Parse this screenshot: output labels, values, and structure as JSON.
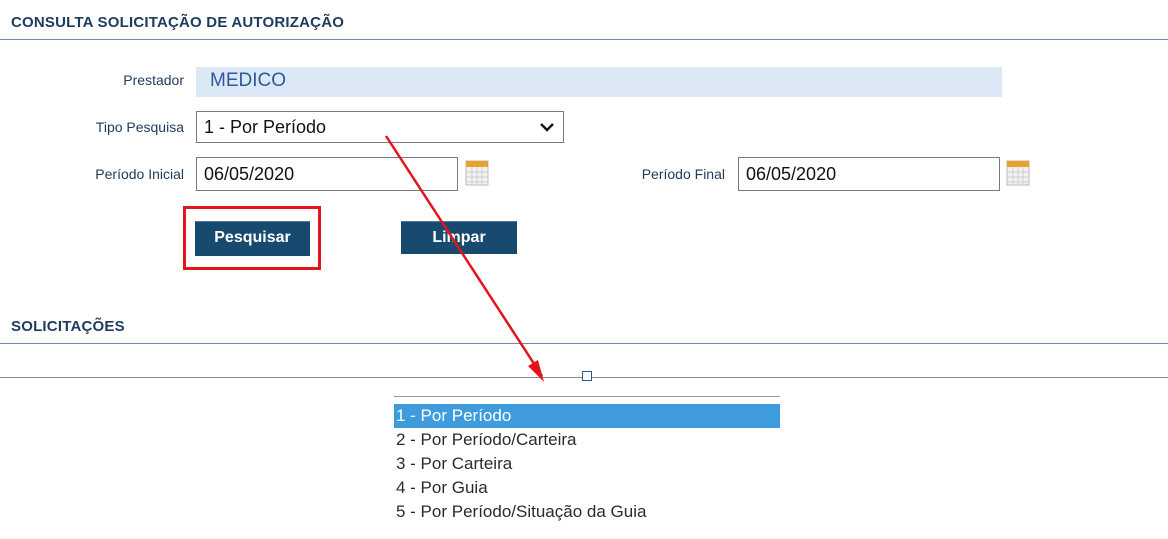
{
  "header": {
    "title": "CONSULTA SOLICITAÇÃO DE AUTORIZAÇÃO"
  },
  "form": {
    "prestador_label": "Prestador",
    "prestador_value": "MEDICO",
    "tipo_label": "Tipo Pesquisa",
    "tipo_value": "1 - Por Período",
    "periodo_inicial_label": "Período Inicial",
    "periodo_inicial_value": "06/05/2020",
    "periodo_final_label": "Período Final",
    "periodo_final_value": "06/05/2020",
    "search_button": "Pesquisar",
    "clear_button": "Limpar"
  },
  "results": {
    "title": "SOLICITAÇÕES"
  },
  "dropdown": {
    "options": [
      "1 - Por Período",
      "2 - Por Período/Carteira",
      "3 - Por Carteira",
      "4 - Por Guia",
      "5 - Por Período/Situação da Guia"
    ],
    "selected_index": 0
  },
  "colors": {
    "primary": "#18496e",
    "annotation": "#e3141c",
    "selection": "#3e9cdc",
    "field_bg": "#dde8f7"
  },
  "icons": [
    "chevron-down-icon",
    "calendar-icon",
    "arrow-annotation-icon"
  ]
}
